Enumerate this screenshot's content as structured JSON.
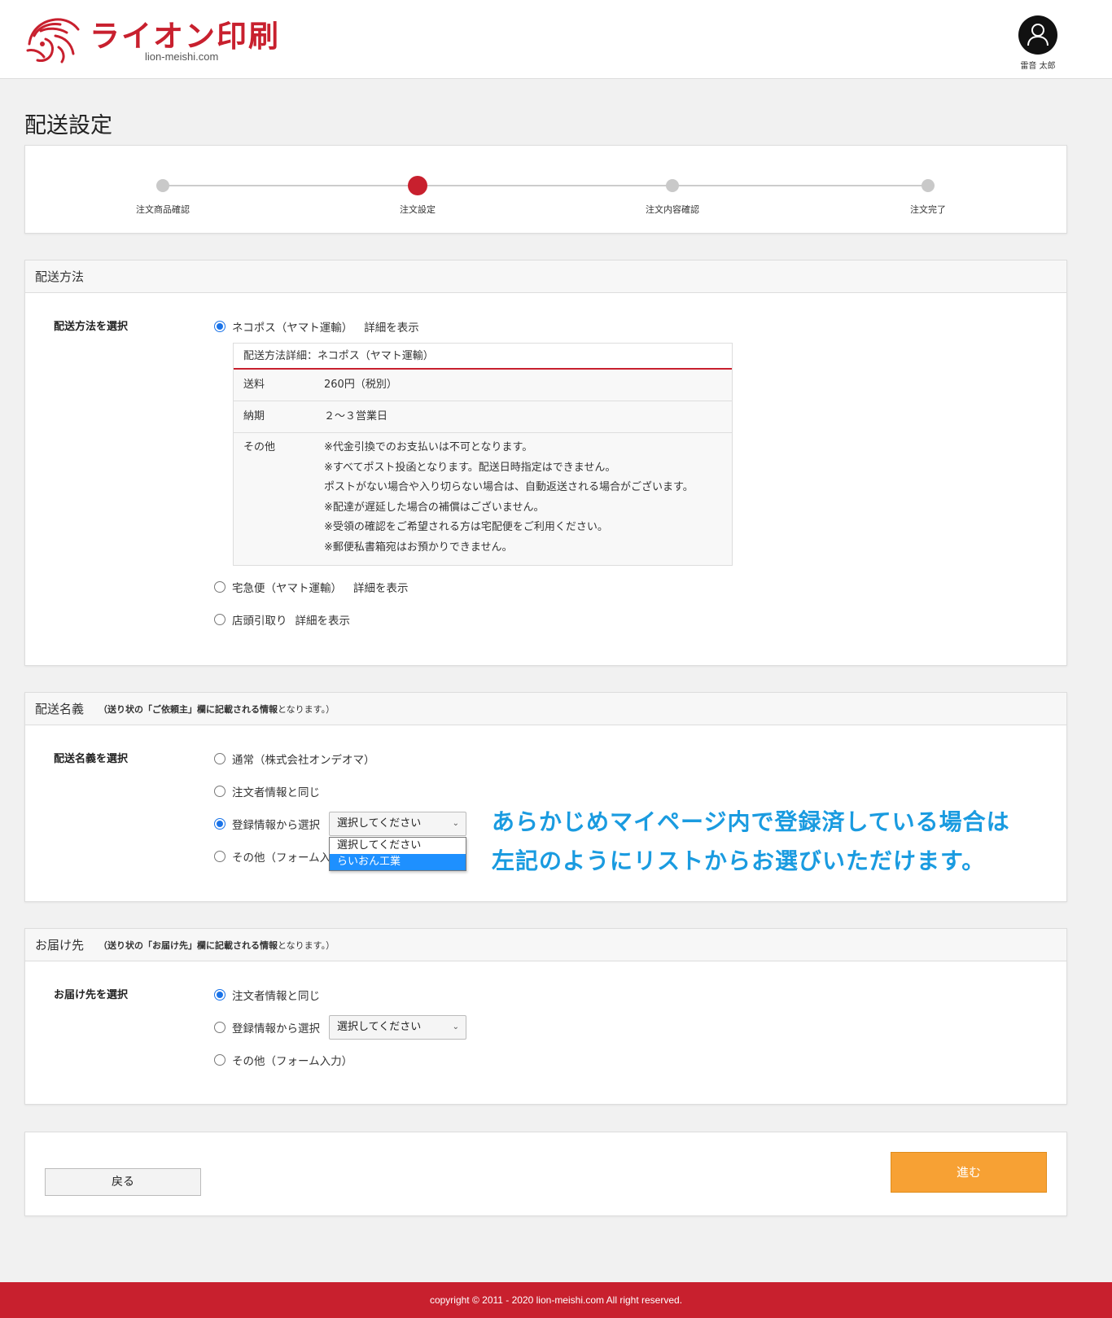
{
  "header": {
    "logo_text": "ライオン印刷",
    "logo_domain": "lion-meishi.com",
    "user_name": "雷音 太郎"
  },
  "page_title": "配送設定",
  "steps": [
    {
      "label": "注文商品確認",
      "active": false
    },
    {
      "label": "注文設定",
      "active": true
    },
    {
      "label": "注文内容確認",
      "active": false
    },
    {
      "label": "注文完了",
      "active": false
    }
  ],
  "shipping_method": {
    "section_title": "配送方法",
    "row_label": "配送方法を選択",
    "options": [
      {
        "label": "ネコポス（ヤマト運輸）",
        "link": "詳細を表示",
        "checked": true
      },
      {
        "label": "宅急便（ヤマト運輸）",
        "link": "詳細を表示",
        "checked": false
      },
      {
        "label": "店頭引取り",
        "link": "詳細を表示",
        "checked": false
      }
    ],
    "detail": {
      "title": "配送方法詳細：ネコポス（ヤマト運輸）",
      "rows": [
        {
          "key": "送料",
          "value": "260円（税別）"
        },
        {
          "key": "納期",
          "value": "２～３営業日"
        }
      ],
      "other_key": "その他",
      "other_lines": [
        "※代金引換でのお支払いは不可となります。",
        "※すべてポスト投函となります。配送日時指定はできません。",
        "ポストがない場合や入り切らない場合は、自動返送される場合がございます。",
        "※配達が遅延した場合の補償はございません。",
        "※受領の確認をご希望される方は宅配便をご利用ください。",
        "※郵便私書箱宛はお預かりできません。"
      ]
    }
  },
  "shipping_name": {
    "section_title": "配送名義",
    "note_prefix": "（送り状の「ご依頼主」欄に記載される情報",
    "note_suffix": "となります。）",
    "row_label": "配送名義を選択",
    "options": [
      {
        "label": "通常（株式会社オンデオマ）",
        "checked": false
      },
      {
        "label": "注文者情報と同じ",
        "checked": false
      },
      {
        "label": "登録情報から選択",
        "checked": true
      },
      {
        "label": "その他（フォーム入力）",
        "checked": false
      }
    ],
    "select_value": "選択してください",
    "dropdown_options": [
      "選択してください",
      "らいおん工業"
    ],
    "highlighted_option": "らいおん工業"
  },
  "callout": {
    "line1": "あらかじめマイページ内で登録済している場合は",
    "line2": "左記のようにリストからお選びいただけます。"
  },
  "delivery": {
    "section_title": "お届け先",
    "note_prefix": "（送り状の「お届け先」欄に記載される情報",
    "note_suffix": "となります。）",
    "row_label": "お届け先を選択",
    "options": [
      {
        "label": "注文者情報と同じ",
        "checked": true
      },
      {
        "label": "登録情報から選択",
        "checked": false
      },
      {
        "label": "その他（フォーム入力）",
        "checked": false
      }
    ],
    "select_value": "選択してください"
  },
  "actions": {
    "back_label": "戻る",
    "next_label": "進む"
  },
  "footer": {
    "copyright": "copyright © 2011 - 2020 lion-meishi.com All right reserved."
  },
  "colors": {
    "brand": "#c8202e",
    "accent_button": "#f7a134",
    "radio_checked": "#1a73e8",
    "callout": "#1a9be0"
  }
}
